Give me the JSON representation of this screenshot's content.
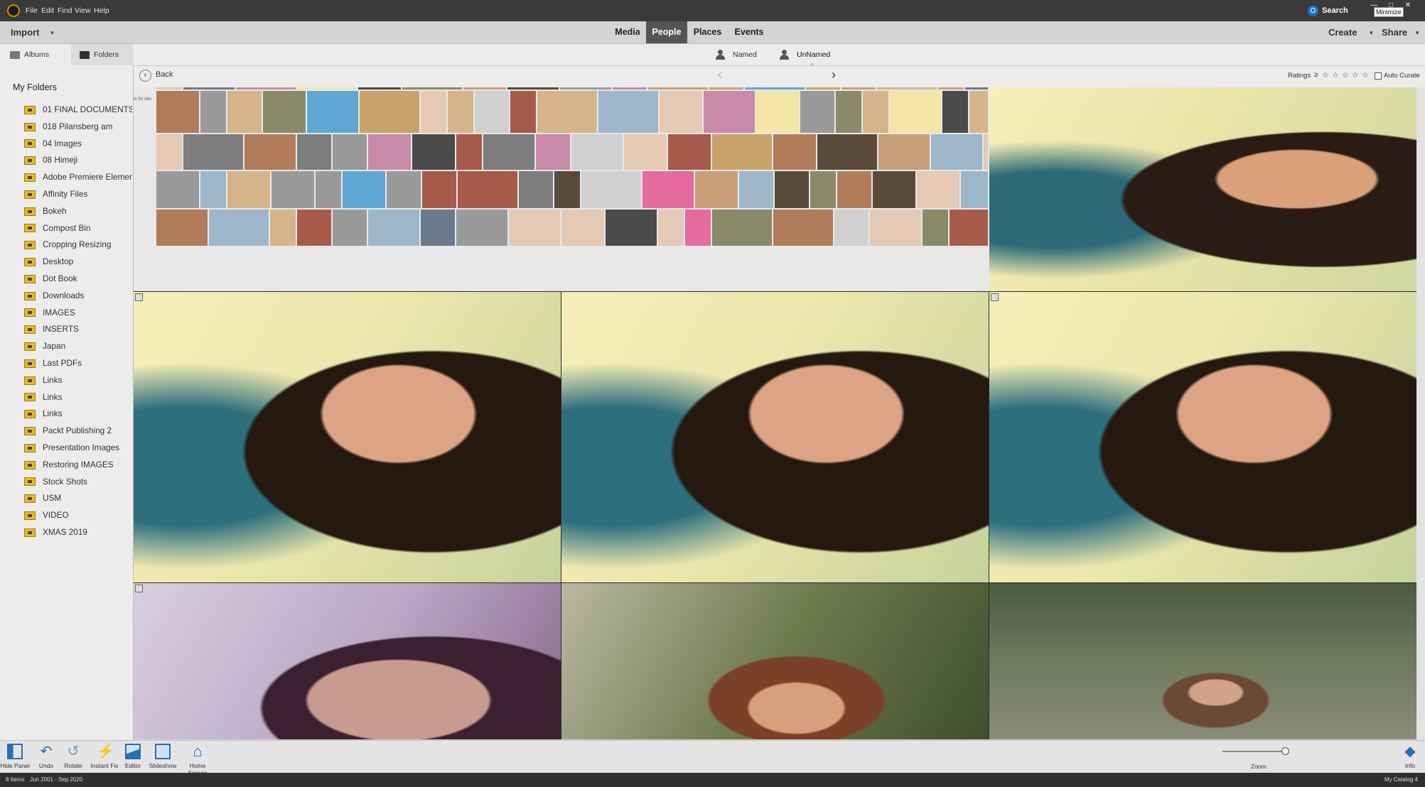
{
  "menu": [
    "File",
    "Edit",
    "Find",
    "View",
    "Help"
  ],
  "search_label": "Search",
  "window_buttons": {
    "minimize": "—",
    "maximize": "□",
    "close": "✕"
  },
  "tooltip": "Minimize",
  "import_label": "Import",
  "mode_tabs": [
    "Media",
    "People",
    "Places",
    "Events"
  ],
  "active_mode_tab": "People",
  "create_label": "Create",
  "share_label": "Share",
  "sidebar_tabs": {
    "albums": "Albums",
    "folders": "Folders"
  },
  "people_filter": {
    "named": "Named",
    "unnamed": "UnNamed"
  },
  "back_label": "Back",
  "ratings_label": "Ratings",
  "ratings_operator": "≥",
  "rating_stars": [
    "☆",
    "☆",
    "☆",
    "☆",
    "☆"
  ],
  "auto_curate_label": "Auto Curate",
  "sidebar": {
    "title": "My Folders",
    "folders": [
      "01 FINAL DOCUMENTS",
      "018 Pilansberg am",
      "04 Images",
      "08 Himeji",
      "Adobe Premiere Elemen",
      "Affinity Files",
      "Bokeh",
      "Compost Bin",
      "Cropping Resizing",
      "Desktop",
      "Dot Book",
      "Downloads",
      "IMAGES",
      "INSERTS",
      "Japan",
      "Last PDFs",
      "Links",
      "Links",
      "Links",
      "Packt Publishing 2",
      "Presentation Images",
      "Restoring IMAGES",
      "Stock Shots",
      "USM",
      "VIDEO",
      "XMAS 2019"
    ]
  },
  "clipped_label": "ts for Abo",
  "toolbar": {
    "hide_panel": "Hide Panel",
    "undo": "Undo",
    "rotate": "Rotate",
    "instant_fix": "Instant Fix",
    "editor": "Editor",
    "slideshow": "Slideshow",
    "home_screen": "Home Screen",
    "zoom": "Zoom",
    "info": "Info"
  },
  "zoom_level": 0.9,
  "status": {
    "count": "8 Items",
    "date_range": "Jun 2001 - Sep 2020",
    "catalog": "My Catalog 4"
  },
  "colors": {
    "accent": "#1a73d9",
    "active_tab": "#555555",
    "folder_icon": "#e8b92a"
  }
}
